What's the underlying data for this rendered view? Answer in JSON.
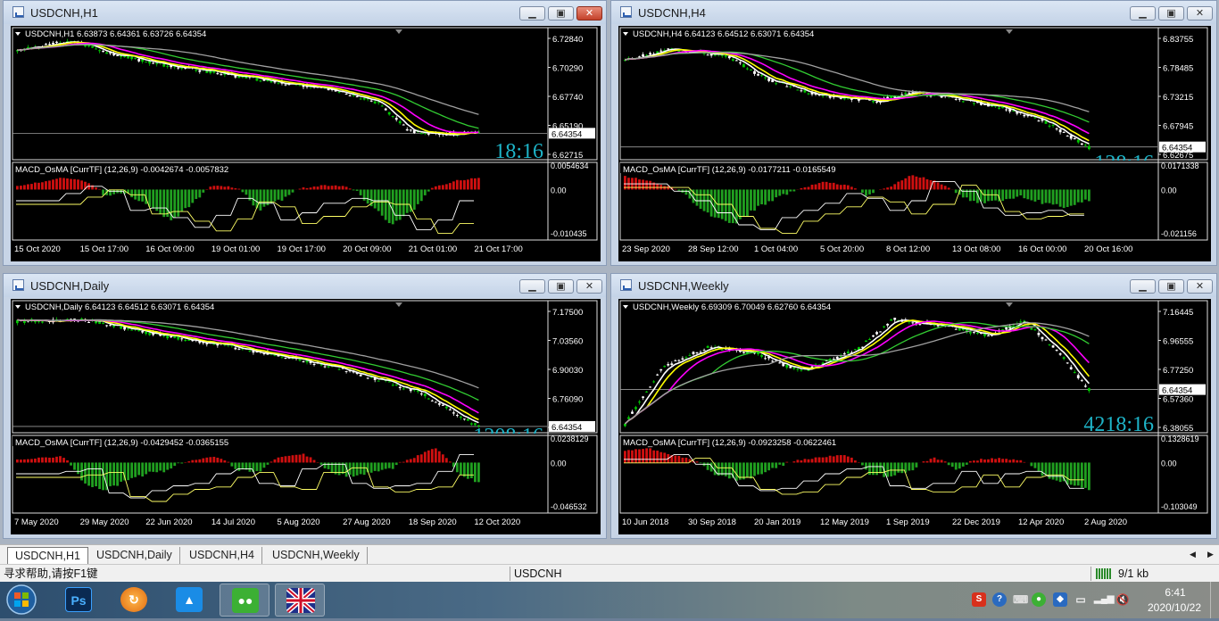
{
  "tabs": [
    {
      "label": "USDCNH,H1",
      "active": true
    },
    {
      "label": "USDCNH,Daily",
      "active": false
    },
    {
      "label": "USDCNH,H4",
      "active": false
    },
    {
      "label": "USDCNH,Weekly",
      "active": false
    }
  ],
  "status": {
    "help": "寻求帮助,请按F1键",
    "symbol": "USDCNH",
    "traffic": "9/1 kb"
  },
  "taskbar": {
    "time": "6:41",
    "date": "2020/10/22",
    "apps": [
      "start-button",
      "photoshop-icon",
      "browser-icon",
      "cloud-drive-icon",
      "wechat-icon",
      "metatrader-icon"
    ]
  },
  "colors": {
    "bull_candle": "#00c800",
    "bear_candle": "#ffffff",
    "ma_fast": "#ffffff",
    "ma_yellow": "#ffff00",
    "ma_magenta": "#ff00ff",
    "ma_green": "#32cd32",
    "ma_gray": "#a0a0a0",
    "macd_pos": "#d01010",
    "macd_neg": "#20a020",
    "timer": "#1eb4c8"
  },
  "windows": [
    {
      "id": "h1",
      "title": "USDCNH,H1",
      "close_active": true,
      "header": "USDCNH,H1  6.63873 6.64361 6.63726 6.64354",
      "price_ticks": [
        "6.72840",
        "6.70290",
        "6.67740",
        "6.65190",
        "6.62715"
      ],
      "price_range": [
        6.621,
        6.732
      ],
      "current_price": "6.64354",
      "current_value": 6.64354,
      "timer": "18:16",
      "timer_partial": false,
      "macd_label": "MACD_OsMA [CurrTF] (12,26,9) -0.0042674 -0.0057832",
      "macd_ticks": [
        "0.0054634",
        "0.00",
        "-0.010435"
      ],
      "dates": [
        "15 Oct 2020",
        "15 Oct 17:00",
        "16 Oct 09:00",
        "19 Oct 01:00",
        "19 Oct 17:00",
        "20 Oct 09:00",
        "21 Oct 01:00",
        "21 Oct 17:00"
      ],
      "trend": [
        [
          0,
          6.715
        ],
        [
          0.12,
          6.722
        ],
        [
          0.2,
          6.712
        ],
        [
          0.3,
          6.703
        ],
        [
          0.42,
          6.696
        ],
        [
          0.55,
          6.688
        ],
        [
          0.68,
          6.681
        ],
        [
          0.78,
          6.67
        ],
        [
          0.85,
          6.645
        ],
        [
          0.93,
          6.643
        ],
        [
          1.0,
          6.644
        ]
      ],
      "macd_hist": [
        0.2,
        0.5,
        0.8,
        0.6,
        -0.2,
        -0.1,
        -0.5,
        -0.9,
        -0.4,
        0.3,
        0.1,
        -0.6,
        -0.3,
        0.1,
        0.3,
        0.2,
        -0.4,
        -1.0,
        -0.6,
        0.2,
        0.6,
        0.8
      ]
    },
    {
      "id": "h4",
      "title": "USDCNH,H4",
      "close_active": false,
      "header": "USDCNH,H4  6.64123 6.64512 6.63071 6.64354",
      "price_ticks": [
        "6.83755",
        "6.78485",
        "6.73215",
        "6.67945",
        "6.62675"
      ],
      "price_range": [
        6.621,
        6.851
      ],
      "current_price": "6.64354",
      "current_value": 6.64354,
      "timer": "128:16",
      "timer_partial": true,
      "macd_label": "MACD_OsMA [CurrTF] (12,26,9) -0.0177211 -0.0165549",
      "macd_ticks": [
        "0.0171338",
        "0.00",
        "-0.021156"
      ],
      "dates": [
        "23 Sep 2020",
        "28 Sep 12:00",
        "1 Oct 04:00",
        "5 Oct 20:00",
        "8 Oct 12:00",
        "13 Oct 08:00",
        "16 Oct 00:00",
        "20 Oct 16:00"
      ],
      "trend": [
        [
          0,
          6.8
        ],
        [
          0.1,
          6.815
        ],
        [
          0.22,
          6.805
        ],
        [
          0.3,
          6.765
        ],
        [
          0.42,
          6.735
        ],
        [
          0.55,
          6.725
        ],
        [
          0.62,
          6.742
        ],
        [
          0.72,
          6.728
        ],
        [
          0.82,
          6.712
        ],
        [
          0.9,
          6.69
        ],
        [
          1.0,
          6.643
        ]
      ],
      "macd_hist": [
        0.9,
        0.6,
        0.2,
        -0.3,
        -0.8,
        -1.0,
        -0.5,
        -0.2,
        0.1,
        0.5,
        0.3,
        -0.2,
        0.2,
        1.0,
        0.6,
        -0.1,
        -0.4,
        -0.3,
        -0.2,
        -0.4,
        -0.5,
        -0.3
      ]
    },
    {
      "id": "daily",
      "title": "USDCNH,Daily",
      "close_active": false,
      "header": "USDCNH,Daily  6.64123 6.64512 6.63071 6.64354",
      "price_ticks": [
        "7.17500",
        "7.03560",
        "6.90030",
        "6.76090",
        "6.62560"
      ],
      "price_range": [
        6.615,
        7.205
      ],
      "current_price": "6.64354",
      "current_value": 6.64354,
      "timer": "1208:16",
      "timer_partial": true,
      "macd_label": "MACD_OsMA [CurrTF] (12,26,9) -0.0429452 -0.0365155",
      "macd_ticks": [
        "0.0238129",
        "0.00",
        "-0.046532"
      ],
      "dates": [
        "7 May 2020",
        "29 May 2020",
        "22 Jun 2020",
        "14 Jul 2020",
        "5 Aug 2020",
        "27 Aug 2020",
        "18 Sep 2020",
        "12 Oct 2020"
      ],
      "trend": [
        [
          0,
          7.12
        ],
        [
          0.15,
          7.125
        ],
        [
          0.3,
          7.06
        ],
        [
          0.45,
          7.01
        ],
        [
          0.58,
          6.96
        ],
        [
          0.7,
          6.905
        ],
        [
          0.8,
          6.845
        ],
        [
          0.88,
          6.79
        ],
        [
          0.95,
          6.7
        ],
        [
          1.0,
          6.643
        ]
      ],
      "macd_hist": [
        0.2,
        0.3,
        0.4,
        -0.6,
        -0.8,
        -0.5,
        -0.3,
        -0.2,
        0.2,
        0.4,
        -0.2,
        -0.3,
        0.4,
        0.6,
        -0.2,
        -0.4,
        -0.3,
        -0.2,
        0.3,
        1.0,
        -0.3,
        -0.6
      ]
    },
    {
      "id": "weekly",
      "title": "USDCNH,Weekly",
      "close_active": false,
      "header": "USDCNH,Weekly  6.69309 6.70049 6.62760 6.64354",
      "price_ticks": [
        "7.16445",
        "6.96555",
        "6.77250",
        "6.57360",
        "6.38055"
      ],
      "price_range": [
        6.365,
        7.205
      ],
      "current_price": "6.64354",
      "current_value": 6.64354,
      "timer": "4218:16",
      "timer_partial": false,
      "macd_label": "MACD_OsMA [CurrTF] (12,26,9) -0.0923258 -0.0622461",
      "macd_ticks": [
        "0.1328619",
        "0.00",
        "-0.103049"
      ],
      "dates": [
        "10 Jun 2018",
        "30 Sep 2018",
        "20 Jan 2019",
        "12 May 2019",
        "1 Sep 2019",
        "22 Dec 2019",
        "12 Apr 2020",
        "2 Aug 2020"
      ],
      "trend": [
        [
          0,
          6.42
        ],
        [
          0.08,
          6.78
        ],
        [
          0.18,
          6.92
        ],
        [
          0.28,
          6.88
        ],
        [
          0.38,
          6.76
        ],
        [
          0.5,
          6.9
        ],
        [
          0.58,
          7.1
        ],
        [
          0.7,
          7.05
        ],
        [
          0.78,
          6.99
        ],
        [
          0.86,
          7.08
        ],
        [
          0.93,
          6.9
        ],
        [
          1.0,
          6.643
        ]
      ],
      "macd_hist": [
        0.8,
        1.0,
        0.6,
        0.2,
        -0.3,
        -0.5,
        -0.4,
        -0.1,
        0.2,
        0.4,
        0.5,
        -0.3,
        -0.4,
        -0.2,
        0.3,
        -0.2,
        0.2,
        0.3,
        0.1,
        -0.4,
        -0.6,
        -0.8
      ]
    }
  ]
}
